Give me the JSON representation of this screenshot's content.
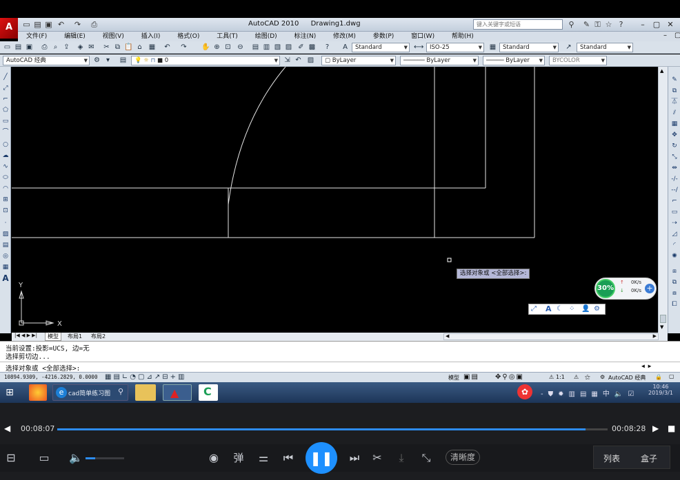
{
  "title_bar": {
    "logo": "A",
    "app_name": "AutoCAD 2010",
    "file_name": "Drawing1.dwg",
    "search_placeholder": "键入关键字或短语"
  },
  "menu": [
    "文件(F)",
    "编辑(E)",
    "视图(V)",
    "插入(I)",
    "格式(O)",
    "工具(T)",
    "绘图(D)",
    "标注(N)",
    "修改(M)",
    "参数(P)",
    "窗口(W)",
    "帮助(H)"
  ],
  "styles_toolbar": {
    "text_style": "Standard",
    "dim_style": "ISO-25",
    "table_style": "Standard",
    "multileader_style": "Standard"
  },
  "layers_toolbar": {
    "workspace": "AutoCAD 经典",
    "layer": "0",
    "color": "ByLayer",
    "linetype": "ByLayer",
    "lineweight": "ByLayer",
    "plotstyle": "BYCOLOR"
  },
  "canvas": {
    "tooltip": "选择对象或 <全部选择>:",
    "ucs_x": "X",
    "ucs_y": "Y"
  },
  "layout_tabs": [
    "模型",
    "布局1",
    "布局2"
  ],
  "command": {
    "line1": "当前设置:投影=UCS, 边=无",
    "line2": "选择剪切边...",
    "prompt": "选择对象或 <全部选择>:"
  },
  "status": {
    "coords": "10894.9309, -4216.2829, 0.0000",
    "model_label": "模型",
    "annotation_scale": "1:1",
    "workspace": "AutoCAD 经典"
  },
  "net_widget": {
    "percent": "30%",
    "up": "0K/s",
    "down": "0K/s"
  },
  "taskbar": {
    "search_text": "cad简单练习图",
    "clock_time": "10:46",
    "clock_date": "2019/3/1",
    "ime": "中"
  },
  "player": {
    "time_current": "00:08:07",
    "time_total": "00:08:28",
    "progress": 0.96,
    "volume": 0.25,
    "danmu_label": "弹",
    "quality_label": "清晰度",
    "list_label": "列表",
    "box_label": "盒子"
  },
  "colors": {
    "accent_blue": "#1e90ff",
    "progress_blue": "#2d8cf0",
    "drawing_line": "#e6e6e6",
    "net_green": "#1a9e55"
  }
}
